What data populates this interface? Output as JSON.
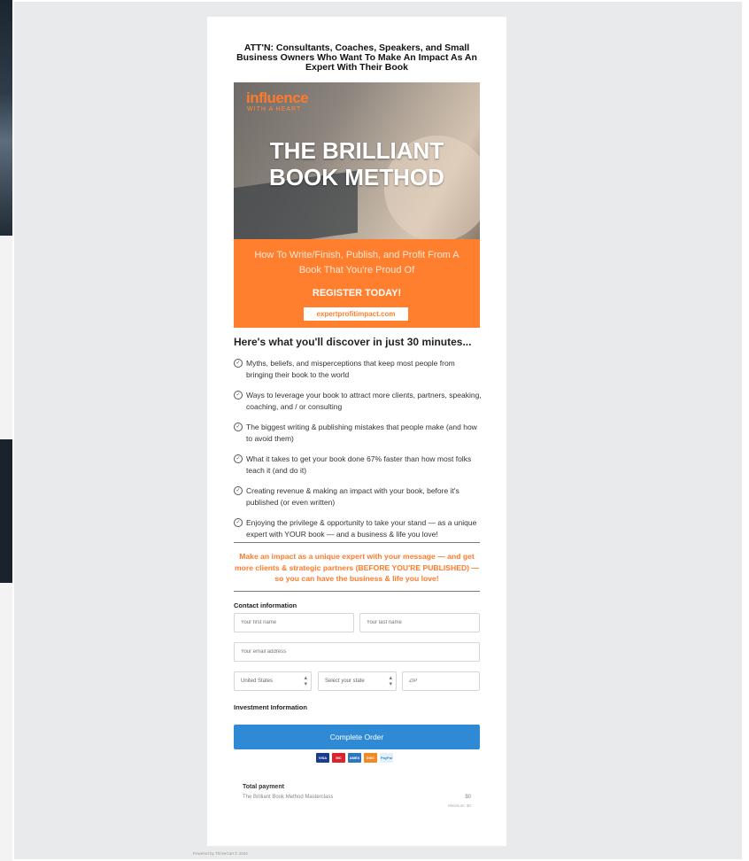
{
  "headline": "ATT'N: Consultants, Coaches, Speakers, and Small Business Owners Who Want To Make An Impact As An Expert With Their Book",
  "hero": {
    "brand": "influence",
    "brand_sub": "WITH A HEART",
    "title": "THE BRILLIANT BOOK METHOD",
    "subtitle": "How To Write/Finish, Publish, and Profit From A Book That You're Proud Of",
    "register": "REGISTER TODAY!",
    "url": "expertprofitimpact.com"
  },
  "discover_heading": "Here's what you'll discover in just 30 minutes...",
  "bullets": [
    "Myths, beliefs, and misperceptions that keep most people from bringing their book to the world",
    "Ways to leverage your book to attract more clients, partners, speaking, coaching, and / or consulting",
    "The biggest writing & publishing mistakes that people make (and how to avoid them)",
    "What it takes to get your book done 67% faster than how most folks teach it (and do it)",
    "Creating revenue & making an impact with your book, before it's published (or even written)",
    "Enjoying the privilege & opportunity to take your stand — as a unique expert with YOUR book — and a business & life you love!"
  ],
  "pitch": "Make an impact as a unique expert with your message — and get more clients & strategic partners (BEFORE YOU'RE PUBLISHED) — so you can have the business & life you love!",
  "form": {
    "contact_heading": "Contact information",
    "first_name_placeholder": "Your first name",
    "last_name_placeholder": "Your last name",
    "email_placeholder": "Your email address",
    "country": "United States",
    "state": "Select your state",
    "zip_placeholder": "ZIP",
    "investment_heading": "Investment Information",
    "submit": "Complete Order"
  },
  "payment_cards": [
    "VISA",
    "MC",
    "AMEX",
    "DISC",
    "PayPal"
  ],
  "card_colors": [
    "#1a3d8f",
    "#d9232d",
    "#2e77bc",
    "#f08a24",
    "#1c8fd6"
  ],
  "summary": {
    "title": "Total payment",
    "item": "The Brilliant Book Method Masterclass",
    "price": "$0",
    "note": "Minimum: $0"
  },
  "powered_by": "Powered by ThriveCart © 2024"
}
